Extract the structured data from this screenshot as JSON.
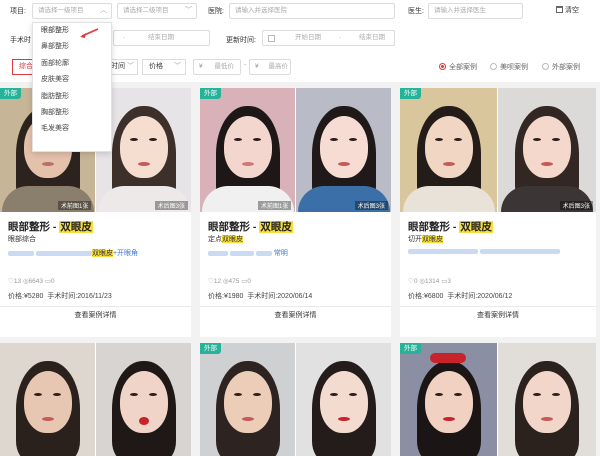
{
  "filters": {
    "project_label": "项目:",
    "project_first_placeholder": "请选择一级项目",
    "project_second_placeholder": "请选择二级项目",
    "hospital_label": "医院:",
    "hospital_placeholder": "请输入并选择医院",
    "doctor_label": "医生:",
    "doctor_placeholder": "请输入并选择医生",
    "clear_label": "清空",
    "surgery_time_label": "手术时",
    "end_date_placeholder": "结束日期",
    "update_time_label": "更新时间:",
    "update_start_placeholder": "开始日期",
    "update_dash": "-",
    "update_end_placeholder": "结束日期"
  },
  "sort": {
    "tab_label": "综合",
    "time_label": "时间",
    "price_label": "价格",
    "currency": "¥",
    "min_price_placeholder": "最低价",
    "max_price_placeholder": "最高价",
    "price_dash": "-"
  },
  "case_filter": {
    "options": [
      "全部案例",
      "美呗案例",
      "外部案例"
    ],
    "selected": "全部案例"
  },
  "dropdown": {
    "items": [
      "眼部整形",
      "鼻部整形",
      "面部轮廓",
      "皮肤美容",
      "脂肪整形",
      "胸部整形",
      "毛发美容"
    ]
  },
  "cards": [
    {
      "badge": "外部",
      "caption_before": "术前图1张",
      "caption_after": "术后图3张",
      "category": "眼部整形",
      "title_dash": " - ",
      "procedure": "双眼皮",
      "subtitle": "眼部综合",
      "subtitle_highlight": "",
      "line_highlight": "双眼皮",
      "line_suffix": "+开眼角",
      "views": "13",
      "likes": "6643",
      "comments": "0",
      "price_label": "价格:",
      "price": "¥5280",
      "surgery_label": "手术时间:",
      "date": "2016/11/23",
      "detail": "查看案例详情"
    },
    {
      "badge": "外部",
      "caption_before": "术前图1张",
      "caption_after": "术后图3张",
      "category": "眼部整形",
      "title_dash": " - ",
      "procedure": "双眼皮",
      "subtitle": "定点",
      "subtitle_highlight": "双眼皮",
      "line_highlight": "",
      "line_suffix": "常明",
      "views": "12",
      "likes": "475",
      "comments": "0",
      "price_label": "价格:",
      "price": "¥1980",
      "surgery_label": "手术时间:",
      "date": "2020/06/14",
      "detail": "查看案例详情"
    },
    {
      "badge": "外部",
      "caption_before": "",
      "caption_after": "术后图3张",
      "category": "眼部整形",
      "title_dash": " - ",
      "procedure": "双眼皮",
      "subtitle": "切开",
      "subtitle_highlight": "双眼皮",
      "line_highlight": "",
      "line_suffix": "",
      "views": "0",
      "likes": "1314",
      "comments": "3",
      "price_label": "价格:",
      "price": "¥6800",
      "surgery_label": "手术时间:",
      "date": "2020/06/12",
      "detail": "查看案例详情"
    },
    {
      "badge": ""
    },
    {
      "badge": "外部"
    },
    {
      "badge": "外部"
    }
  ],
  "colors": {
    "accent_red": "#e0383e",
    "badge_green": "#27b39a",
    "highlight_yellow": "#f8de3a",
    "link_blue": "#3a78d8"
  },
  "icons": {
    "clear": "broom-icon",
    "views": "eye-icon",
    "likes": "heart-icon",
    "comments": "comment-icon"
  }
}
